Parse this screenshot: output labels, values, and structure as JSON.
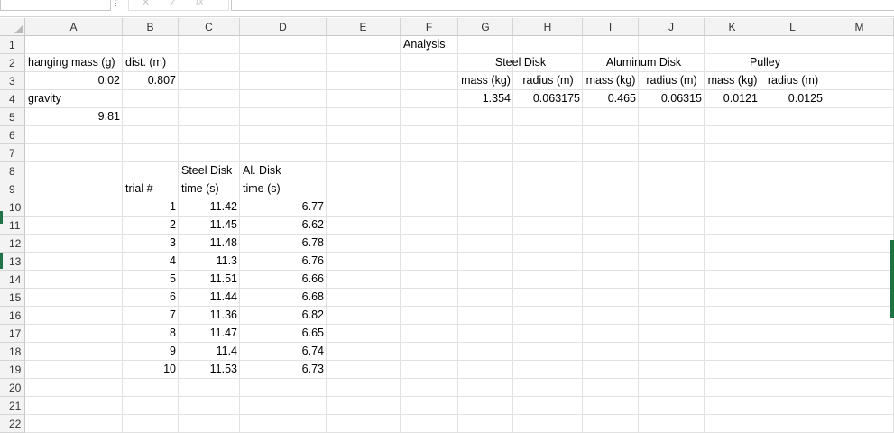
{
  "formula_bar": {
    "name_box": "",
    "formula": "",
    "cancel_glyph": "✕",
    "enter_glyph": "✓",
    "fx_glyph": "fx"
  },
  "columns": [
    "A",
    "B",
    "C",
    "D",
    "E",
    "F",
    "G",
    "H",
    "I",
    "J",
    "K",
    "L",
    "M"
  ],
  "rows": [
    "1",
    "2",
    "3",
    "4",
    "5",
    "6",
    "7",
    "8",
    "9",
    "10",
    "11",
    "12",
    "13",
    "14",
    "15",
    "16",
    "17",
    "18",
    "19",
    "20",
    "21",
    "22"
  ],
  "cells": {
    "title": "Analysis",
    "hanging_mass_label": "hanging mass (g)",
    "dist_label": "dist. (m)",
    "hanging_mass_value": "0.02",
    "dist_value": "0.807",
    "gravity_label": "gravity",
    "gravity_value": "9.81",
    "steel_disk_header": "Steel Disk",
    "aluminum_disk_header": "Aluminum Disk",
    "pulley_header": "Pulley",
    "mass_kg_label": "mass (kg)",
    "radius_m_label": "radius (m)",
    "steel_mass": "1.354",
    "steel_radius": "0.063175",
    "al_mass": "0.465",
    "al_radius": "0.06315",
    "pulley_mass": "0.0121",
    "pulley_radius": "0.0125",
    "steel_disk_col_header": "Steel Disk",
    "al_disk_col_header": "Al. Disk",
    "trial_label": "trial #",
    "time_label": "time (s)"
  },
  "trials": [
    {
      "trial": "1",
      "steel": "11.42",
      "al": "6.77"
    },
    {
      "trial": "2",
      "steel": "11.45",
      "al": "6.62"
    },
    {
      "trial": "3",
      "steel": "11.48",
      "al": "6.78"
    },
    {
      "trial": "4",
      "steel": "11.3",
      "al": "6.76"
    },
    {
      "trial": "5",
      "steel": "11.51",
      "al": "6.66"
    },
    {
      "trial": "6",
      "steel": "11.44",
      "al": "6.68"
    },
    {
      "trial": "7",
      "steel": "11.36",
      "al": "6.82"
    },
    {
      "trial": "8",
      "steel": "11.47",
      "al": "6.65"
    },
    {
      "trial": "9",
      "steel": "11.4",
      "al": "6.74"
    },
    {
      "trial": "10",
      "steel": "11.53",
      "al": "6.73"
    }
  ],
  "colors": {
    "header_bg": "#f3f3f3",
    "gridline": "#e1e1e1",
    "excel_green": "#217346"
  }
}
